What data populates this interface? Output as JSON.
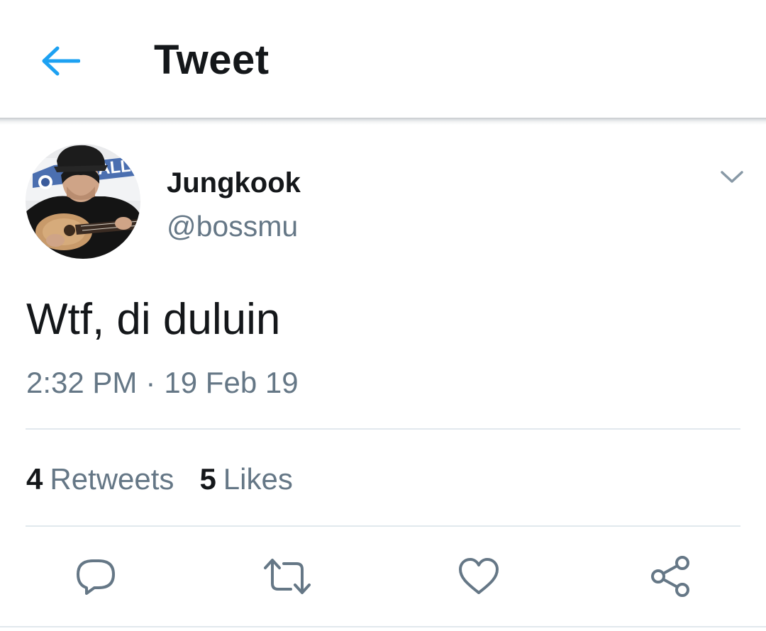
{
  "header": {
    "title": "Tweet",
    "back_icon": "arrow-left-icon"
  },
  "author": {
    "name": "Jungkook",
    "handle": "@bossmu",
    "avatar_icon": "avatar-photo"
  },
  "tweet": {
    "text": "Wtf, di duluin",
    "time": "2:32 PM",
    "separator": "·",
    "date": "19 Feb 19"
  },
  "stats": {
    "retweets_count": "4",
    "retweets_label": "Retweets",
    "likes_count": "5",
    "likes_label": "Likes"
  },
  "actions": [
    {
      "icon": "reply-icon"
    },
    {
      "icon": "retweet-icon"
    },
    {
      "icon": "heart-icon"
    },
    {
      "icon": "share-icon"
    }
  ],
  "colors": {
    "accent": "#1da1f2",
    "primary_text": "#14171a",
    "secondary_text": "#657786",
    "divider": "#e1e8ed"
  }
}
